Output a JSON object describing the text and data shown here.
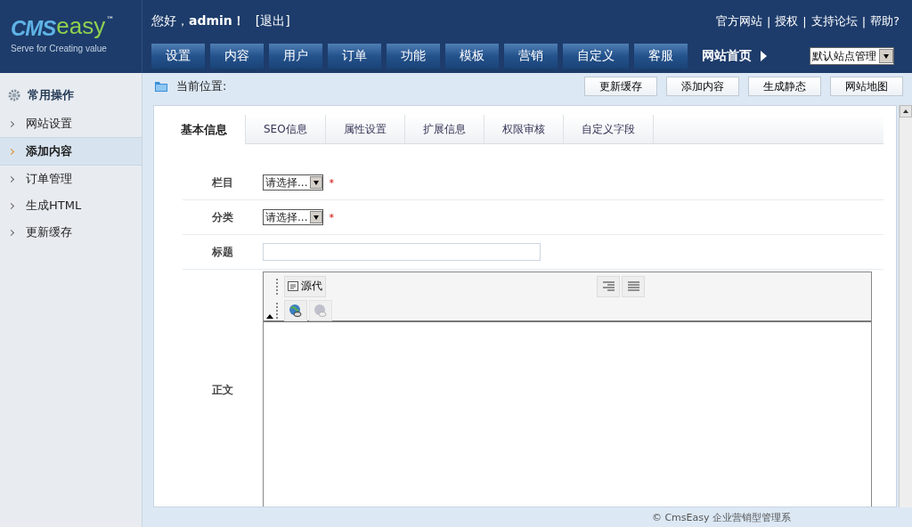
{
  "logo": {
    "mark": "CMS",
    "word": "easy",
    "tm": "™",
    "slogan": "Serve for Creating value"
  },
  "header": {
    "greeting": "您好，",
    "user": "admin！",
    "logout": "[退出]",
    "links": [
      {
        "label": "官方网站"
      },
      {
        "separator": "|",
        "label": "授权"
      },
      {
        "separator": "|",
        "label": "支持论坛"
      },
      {
        "separator": "|",
        "label": "帮助?"
      }
    ],
    "nav": [
      {
        "label": "设置"
      },
      {
        "label": "内容"
      },
      {
        "label": "用户"
      },
      {
        "label": "订单"
      },
      {
        "label": "功能"
      },
      {
        "label": "模板"
      },
      {
        "label": "营销"
      },
      {
        "label": "自定义"
      },
      {
        "label": "客服"
      }
    ],
    "home_link": "网站首页",
    "site_select": "默认站点管理"
  },
  "sidebar": {
    "title": "常用操作",
    "items": [
      {
        "label": "网站设置",
        "selected": false
      },
      {
        "label": "添加内容",
        "selected": true
      },
      {
        "label": "订单管理",
        "selected": false
      },
      {
        "label": "生成HTML",
        "selected": false
      },
      {
        "label": "更新缓存",
        "selected": false
      }
    ]
  },
  "breadcrumb": "当前位置:",
  "toolbar": [
    {
      "label": "更新缓存"
    },
    {
      "label": "添加内容"
    },
    {
      "label": "生成静态"
    },
    {
      "label": "网站地图"
    }
  ],
  "tabs": [
    {
      "label": "基本信息",
      "selected": true
    },
    {
      "label": "SEO信息",
      "selected": false
    },
    {
      "label": "属性设置",
      "selected": false
    },
    {
      "label": "扩展信息",
      "selected": false
    },
    {
      "label": "权限审核",
      "selected": false
    },
    {
      "label": "自定义字段",
      "selected": false
    }
  ],
  "form": [
    {
      "label": "栏目",
      "kind": "select",
      "value": "请选择...",
      "required_mark": "*"
    },
    {
      "label": "分类",
      "kind": "select",
      "value": "请选择...",
      "required_mark": "*"
    },
    {
      "label": "标题",
      "kind": "text"
    },
    {
      "label": "正文",
      "kind": "editor",
      "source_button": "源代"
    }
  ],
  "footer": "© CmsEasy 企业营销型管理系"
}
